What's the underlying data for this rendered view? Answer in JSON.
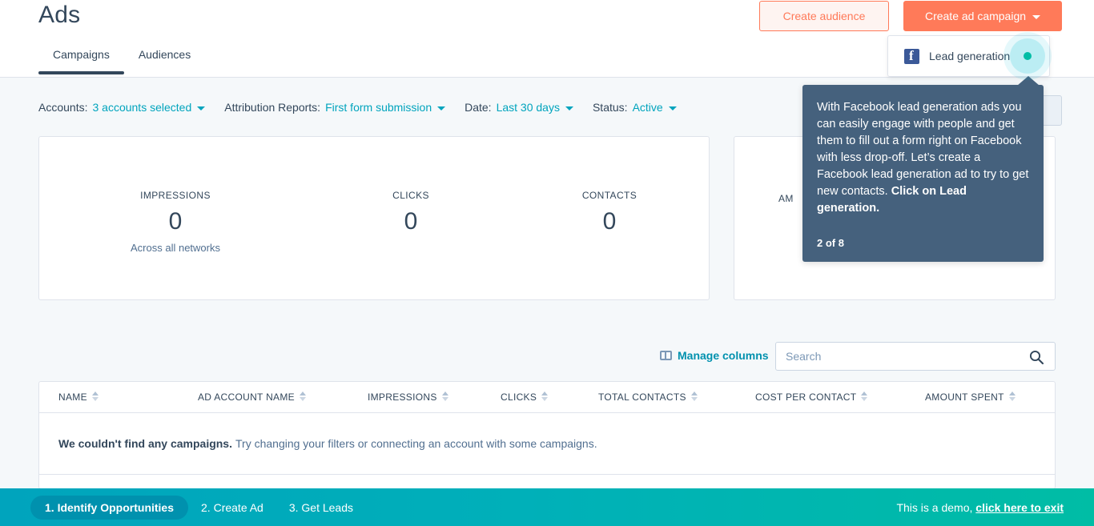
{
  "header": {
    "title": "Ads",
    "tabs": [
      {
        "label": "Campaigns",
        "active": true
      },
      {
        "label": "Audiences",
        "active": false
      }
    ],
    "create_audience_label": "Create audience",
    "create_campaign_label": "Create ad campaign"
  },
  "dropdown": {
    "items": [
      {
        "label": "Lead generation",
        "icon": "facebook-icon"
      }
    ]
  },
  "tooltip": {
    "text_part1": "With Facebook lead generation ads you can easily engage with people and get them to fill out a form right on Facebook with less drop-off. Let’s create a Facebook lead generation ad to try to get new contacts. ",
    "text_bold": "Click on Lead generation.",
    "step_counter": "2 of 8"
  },
  "filters": [
    {
      "label": "Accounts:",
      "value": "3 accounts selected"
    },
    {
      "label": "Attribution Reports:",
      "value": "First form submission"
    },
    {
      "label": "Date:",
      "value": "Last 30 days"
    },
    {
      "label": "Status:",
      "value": "Active"
    }
  ],
  "stats": [
    {
      "name": "IMPRESSIONS",
      "value": "0",
      "sub": "Across all networks"
    },
    {
      "name": "CLICKS",
      "value": "0",
      "sub": ""
    },
    {
      "name": "CONTACTS",
      "value": "0",
      "sub": ""
    }
  ],
  "card_right": {
    "partial_label": "AM"
  },
  "toolbar": {
    "manage_columns_label": "Manage columns",
    "search_placeholder": "Search",
    "search_value": ""
  },
  "table": {
    "columns": [
      "NAME",
      "AD ACCOUNT NAME",
      "IMPRESSIONS",
      "CLICKS",
      "TOTAL CONTACTS",
      "COST PER CONTACT",
      "AMOUNT SPENT"
    ],
    "empty_title": "We couldn't find any campaigns.",
    "empty_body": "Try changing your filters or connecting an account with some campaigns."
  },
  "bottombar": {
    "steps": [
      {
        "label": "1. Identify Opportunities",
        "active": true
      },
      {
        "label": "2. Create Ad",
        "active": false
      },
      {
        "label": "3. Get Leads",
        "active": false
      }
    ],
    "demo_text": "This is a demo,",
    "demo_link": "click here to exit"
  },
  "colors": {
    "brand_orange": "#ff7a59",
    "link_teal": "#00a4bd",
    "dark_navy": "#33475b",
    "tooltip_bg": "#45617d",
    "bar_left": "#00a4bd",
    "bar_right": "#00bda5",
    "page_bg": "#f5f8fa"
  }
}
